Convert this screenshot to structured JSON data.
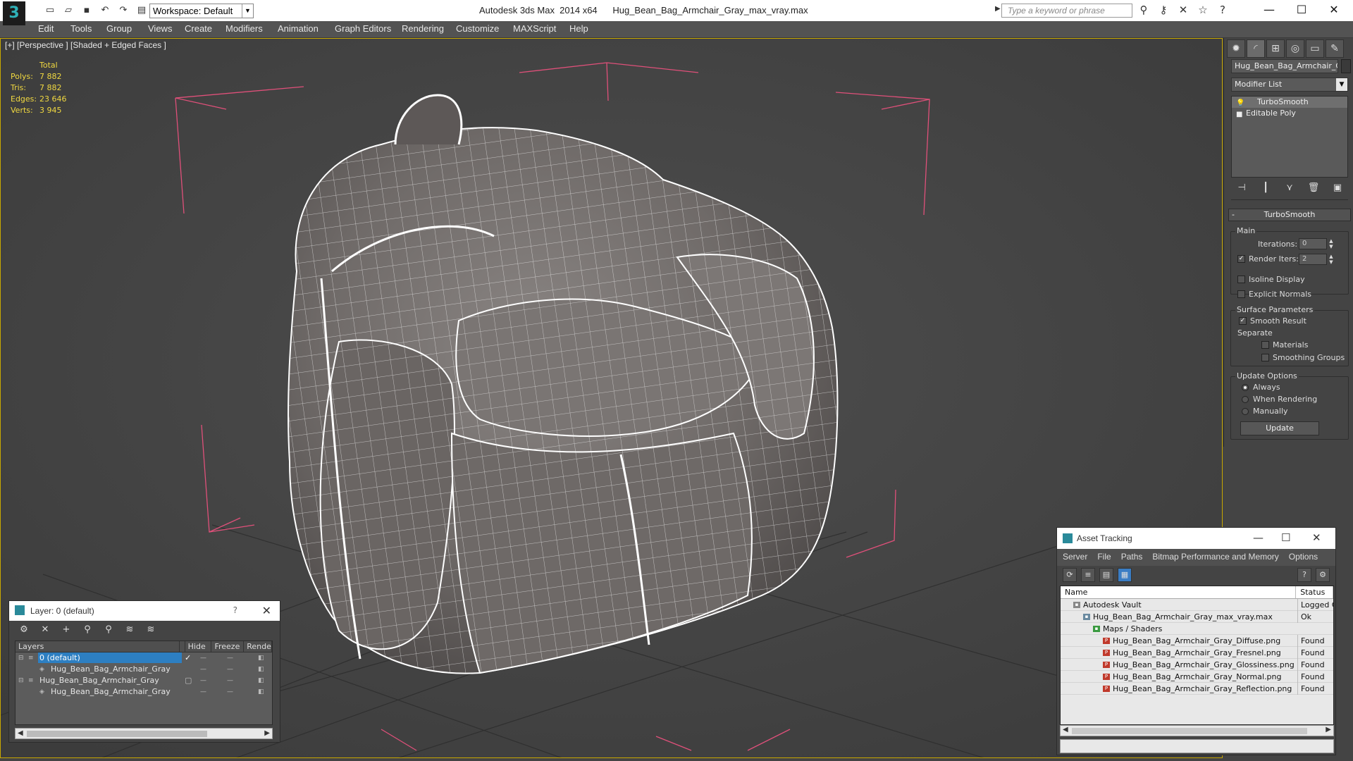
{
  "titlebar": {
    "app_logo": "3",
    "workspace": "Workspace: Default",
    "app_name": "Autodesk 3ds Max  2014 x64",
    "file_name": "Hug_Bean_Bag_Armchair_Gray_max_vray.max",
    "search_placeholder": "Type a keyword or phrase"
  },
  "menu": [
    "Edit",
    "Tools",
    "Group",
    "Views",
    "Create",
    "Modifiers",
    "Animation",
    "Graph Editors",
    "Rendering",
    "Customize",
    "MAXScript",
    "Help"
  ],
  "viewport": {
    "label": "[+] [Perspective ] [Shaded + Edged Faces ]",
    "stats": {
      "header": "Total",
      "rows": [
        {
          "key": "Polys:",
          "value": "7 882"
        },
        {
          "key": "Tris:",
          "value": "7 882"
        },
        {
          "key": "Edges:",
          "value": "23 646"
        },
        {
          "key": "Verts:",
          "value": "3 945"
        }
      ]
    }
  },
  "command_panel": {
    "object_name": "Hug_Bean_Bag_Armchair_Gra",
    "modifier_list": "Modifier List",
    "stack": [
      "TurboSmooth",
      "Editable Poly"
    ],
    "rollout": "TurboSmooth",
    "main_group": "Main",
    "iterations_label": "Iterations:",
    "iterations_value": "0",
    "render_iters_label": "Render Iters:",
    "render_iters_value": "2",
    "isoline": "Isoline Display",
    "explicit_normals": "Explicit Normals",
    "surface_group": "Surface Parameters",
    "smooth_result": "Smooth Result",
    "separate": "Separate",
    "materials": "Materials",
    "smoothing_groups": "Smoothing Groups",
    "update_group": "Update Options",
    "always": "Always",
    "when_rendering": "When Rendering",
    "manually": "Manually",
    "update_button": "Update"
  },
  "layer_window": {
    "title": "Layer: 0 (default)",
    "help": "?",
    "columns": [
      "Layers",
      "Hide",
      "Freeze",
      "Rende"
    ],
    "rows": [
      {
        "name": "0 (default)",
        "selected": true
      },
      {
        "name": "Hug_Bean_Bag_Armchair_Gray",
        "selected": false
      },
      {
        "name": "Hug_Bean_Bag_Armchair_Gray",
        "selected": false
      },
      {
        "name": "Hug_Bean_Bag_Armchair_Gray",
        "selected": false
      }
    ]
  },
  "asset_window": {
    "title": "Asset Tracking",
    "menu": [
      "Server",
      "File",
      "Paths",
      "Bitmap Performance and Memory",
      "Options"
    ],
    "columns": [
      "Name",
      "Status"
    ],
    "rows": [
      {
        "name": "Autodesk Vault",
        "status": "Logged O"
      },
      {
        "name": "Hug_Bean_Bag_Armchair_Gray_max_vray.max",
        "status": "Ok"
      },
      {
        "name": "Maps / Shaders",
        "status": ""
      },
      {
        "name": "Hug_Bean_Bag_Armchair_Gray_Diffuse.png",
        "status": "Found"
      },
      {
        "name": "Hug_Bean_Bag_Armchair_Gray_Fresnel.png",
        "status": "Found"
      },
      {
        "name": "Hug_Bean_Bag_Armchair_Gray_Glossiness.png",
        "status": "Found"
      },
      {
        "name": "Hug_Bean_Bag_Armchair_Gray_Normal.png",
        "status": "Found"
      },
      {
        "name": "Hug_Bean_Bag_Armchair_Gray_Reflection.png",
        "status": "Found"
      }
    ]
  },
  "colors": {
    "stats_text": "#f0d840",
    "selection": "#2d7fc2",
    "bbox": "#e0507a",
    "viewport_bg": "#444444"
  }
}
